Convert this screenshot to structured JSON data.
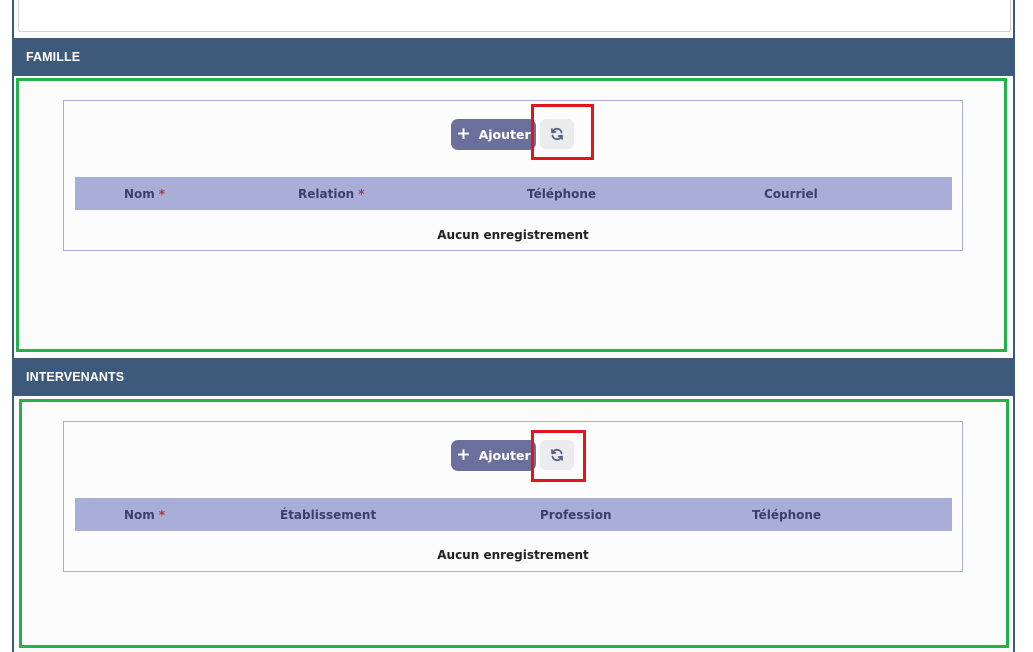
{
  "sections": {
    "famille": {
      "title": "FAMILLE",
      "add_label": "Ajouter",
      "columns": [
        {
          "label": "Nom",
          "required": "*"
        },
        {
          "label": "Relation",
          "required": "*"
        },
        {
          "label": "Téléphone",
          "required": ""
        },
        {
          "label": "Courriel",
          "required": ""
        }
      ],
      "empty_text": "Aucun enregistrement"
    },
    "intervenants": {
      "title": "INTERVENANTS",
      "add_label": "Ajouter",
      "columns": [
        {
          "label": "Nom",
          "required": "*"
        },
        {
          "label": "Établissement",
          "required": ""
        },
        {
          "label": "Profession",
          "required": ""
        },
        {
          "label": "Téléphone",
          "required": ""
        }
      ],
      "empty_text": "Aucun enregistrement"
    }
  },
  "icons": {
    "add": "plus-icon",
    "refresh": "refresh-icon"
  },
  "colors": {
    "header_bg": "#3d5a7a",
    "highlight_green": "#22b14c",
    "highlight_red": "#e3141b",
    "button_bg": "#6a6f9c",
    "table_header_bg": "#a9aed9"
  }
}
